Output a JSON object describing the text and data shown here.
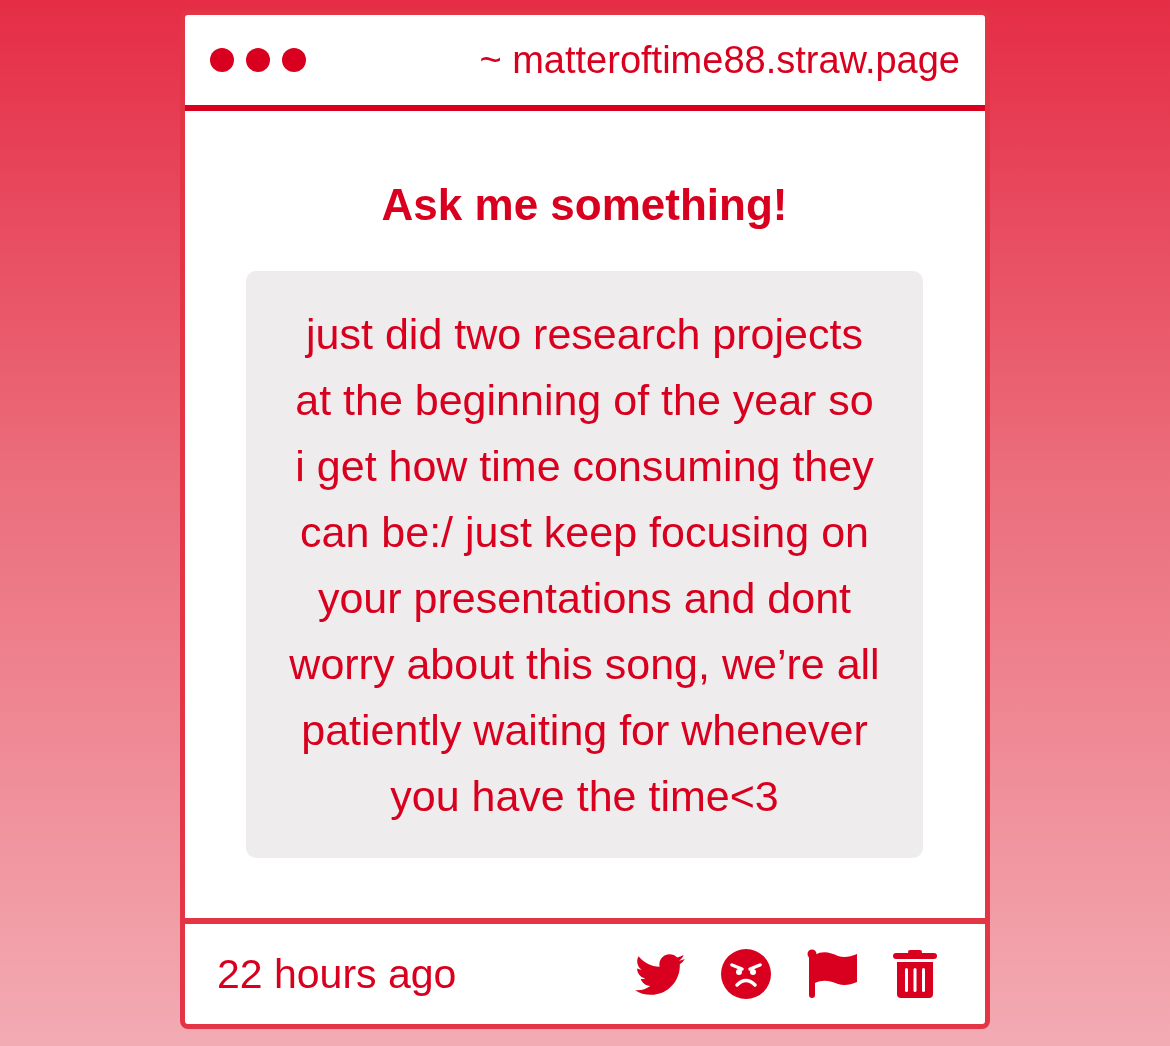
{
  "window": {
    "url": "~ matteroftime88.straw.page"
  },
  "prompt": {
    "title": "Ask me something!"
  },
  "question": {
    "text": "just did two research projects at the beginning of the year so i get how time consuming they can be:/ just keep focusing on your presentations and dont worry about this song, we’re all patiently waiting for whenever you have the time<3"
  },
  "footer": {
    "time": "22 hours ago"
  }
}
